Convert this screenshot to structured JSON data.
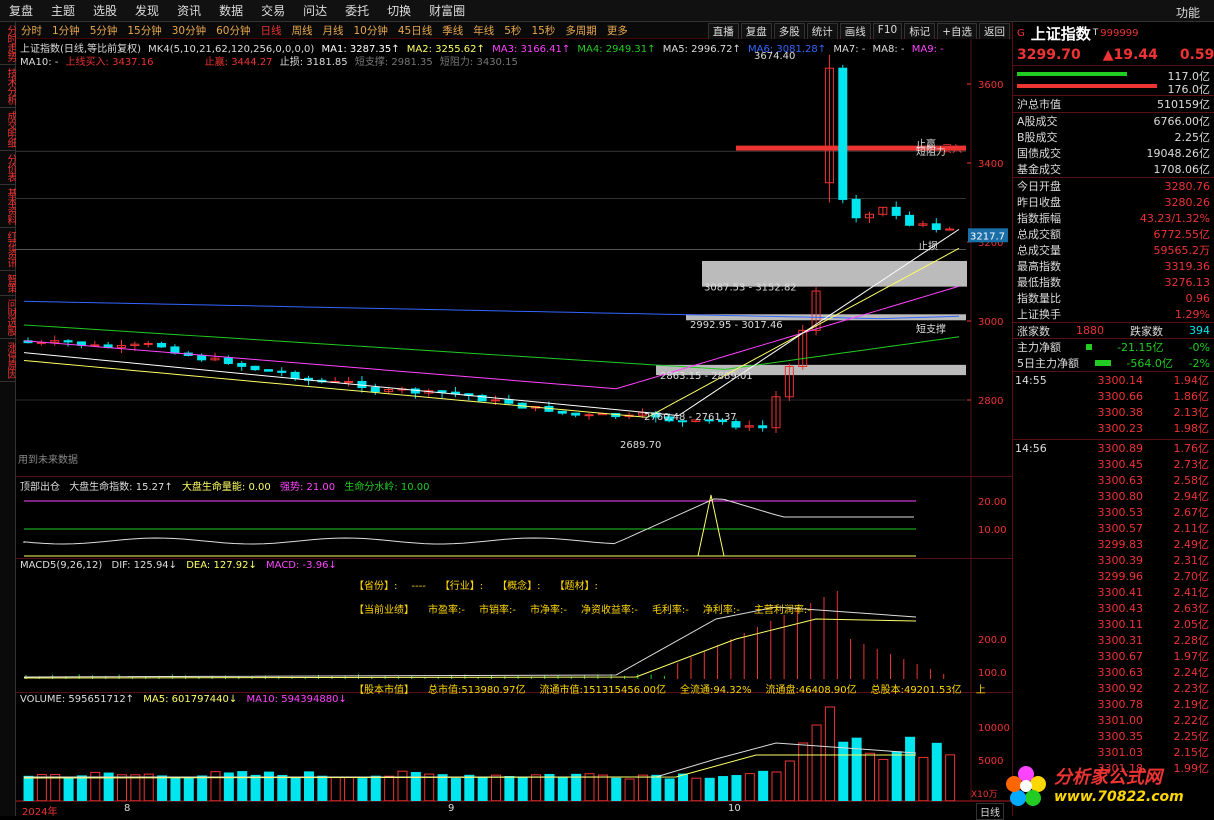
{
  "menu": [
    "复盘",
    "主题",
    "选股",
    "发现",
    "资讯",
    "数据",
    "交易",
    "问达",
    "委托",
    "切换",
    "财富圈"
  ],
  "func_label": "功能",
  "periods": [
    "分时",
    "1分钟",
    "5分钟",
    "15分钟",
    "30分钟",
    "60分钟",
    "日线",
    "周线",
    "月线",
    "10分钟",
    "45日线",
    "季线",
    "年线",
    "5秒",
    "15秒",
    "多周期",
    "更多"
  ],
  "active_period": "日线",
  "tools": [
    "直播",
    "复盘",
    "多股",
    "统计",
    "画线",
    "F10",
    "标记",
    "+自选",
    "返回"
  ],
  "vtabs": [
    "分时走势",
    "技术分析",
    "成交明细",
    "分价表",
    "基本资料",
    "红花资讯",
    "智策",
    "问财选股",
    "涨停原因"
  ],
  "main_legend": {
    "title": "上证指数(日线,等比前复权)",
    "mk": "MK4(5,10,21,62,120,256,0,0,0,0)",
    "ma1": "MA1: 3287.35↑",
    "ma2": "MA2: 3255.62↑",
    "ma3": "MA3: 3166.41↑",
    "ma4": "MA4: 2949.31↑",
    "ma5": "MA5: 2996.72↑",
    "ma6": "MA6: 3081.28↑",
    "ma7": "MA7: -",
    "ma8": "MA8: -",
    "ma9": "MA9: -",
    "ma10": "MA10: -",
    "buy": "上线买入: 3437.16",
    "take": "止赢: 3444.27",
    "stop": "止损: 3181.85",
    "support": "短支撑: 2981.35",
    "resist": "短阻力: 3430.15"
  },
  "main_labels": {
    "high": "3674.40",
    "z1": "3087.53 - 3152.82",
    "z2": "2992.95 - 3017.46",
    "z3": "2863.15 - 2889.01",
    "z4": "2760.48 - 2761.37",
    "low": "2689.70",
    "stop": "止损",
    "support": "短支撑",
    "take": "止赢",
    "resist": "短阻力",
    "buy": "买入",
    "note": "用到未来数据",
    "cur": "3217.7"
  },
  "price_ticks": [
    "3600",
    "3400",
    "3200",
    "3000",
    "2800"
  ],
  "ind1": {
    "name": "顶部出仓",
    "a": "大盘生命指数: 15.27↑",
    "b": "大盘生命量能: 0.00",
    "c": "强势: 21.00",
    "d": "生命分水岭: 10.00",
    "t1": "20.00",
    "t2": "10.00"
  },
  "ind2": {
    "name": "MACD5(9,26,12)",
    "dif": "DIF: 125.94↓",
    "dea": "DEA: 127.92↓",
    "macd": "MACD: -3.96↓",
    "t1": "200.0",
    "t2": "100.0",
    "line1": [
      "【省份】:",
      "----",
      "【行业】:",
      "【概念】:",
      "【题材】:"
    ],
    "line2": [
      "【当前业绩】",
      "市盈率:-",
      "市销率:-",
      "市净率:-",
      "净资收益率:-",
      "毛利率:-",
      "净利率:-",
      "主营利润率:-"
    ],
    "line3": [
      "【股本市值】",
      "总市值:513980.97亿",
      "流通市值:151315456.00亿",
      "全流通:94.32%",
      "流通盘:46408.90亿",
      "总股本:49201.53亿",
      "上"
    ]
  },
  "ind3": {
    "name": "VOLUME: 595651712↑",
    "ma5": "MA5: 601797440↓",
    "ma10": "MA10: 594394880↓",
    "t1": "10000",
    "t2": "5000",
    "unit": "X10万"
  },
  "xaxis": {
    "y": "2024年",
    "m8": "8",
    "m9": "9",
    "m10": "10",
    "period": "日线"
  },
  "quote": {
    "g": "G",
    "name": "上证指数",
    "sup": "T",
    "code": "999999",
    "price": "3299.70",
    "change": "▲19.44",
    "pct": "0.59%",
    "buy_amt": "117.0亿",
    "sell_amt": "176.0亿",
    "rows1": [
      [
        "沪总市值",
        "510159亿"
      ]
    ],
    "rows2": [
      [
        "A股成交",
        "6766.00亿"
      ],
      [
        "B股成交",
        "2.25亿"
      ],
      [
        "国债成交",
        "19048.26亿"
      ],
      [
        "基金成交",
        "1708.06亿"
      ]
    ],
    "rows3": [
      [
        "今日开盘",
        "3280.76"
      ],
      [
        "昨日收盘",
        "3280.26"
      ],
      [
        "指数振幅",
        "43.23/1.32%"
      ],
      [
        "总成交额",
        "6772.55亿"
      ],
      [
        "总成交量",
        "59565.2万"
      ],
      [
        "最高指数",
        "3319.36"
      ],
      [
        "最低指数",
        "3276.13"
      ],
      [
        "指数量比",
        "0.96"
      ],
      [
        "上证换手",
        "1.29%"
      ]
    ],
    "up_label": "涨家数",
    "up": "1880",
    "down_label": "跌家数",
    "down": "394",
    "flow1_label": "主力净额",
    "flow1": "-21.15亿",
    "flow1p": "-0%",
    "flow2_label": "5日主力净额",
    "flow2": "-564.0亿",
    "flow2p": "-2%",
    "t1": "14:55",
    "t2": "14:56",
    "ticks1": [
      [
        "3300.14",
        "1.94亿"
      ],
      [
        "3300.66",
        "1.86亿"
      ],
      [
        "3300.38",
        "2.13亿"
      ],
      [
        "3300.23",
        "1.98亿"
      ]
    ],
    "ticks2": [
      [
        "3300.89",
        "1.76亿"
      ],
      [
        "3300.45",
        "2.73亿"
      ],
      [
        "3300.63",
        "2.58亿"
      ],
      [
        "3300.80",
        "2.94亿"
      ],
      [
        "3300.53",
        "2.67亿"
      ],
      [
        "3300.57",
        "2.11亿"
      ],
      [
        "3299.83",
        "2.49亿"
      ],
      [
        "3300.39",
        "2.31亿"
      ],
      [
        "3299.96",
        "2.70亿"
      ],
      [
        "3300.41",
        "2.41亿"
      ],
      [
        "3300.43",
        "2.63亿"
      ],
      [
        "3300.11",
        "2.05亿"
      ],
      [
        "3300.31",
        "2.28亿"
      ],
      [
        "3300.67",
        "1.97亿"
      ],
      [
        "3300.63",
        "2.24亿"
      ],
      [
        "3300.92",
        "2.23亿"
      ],
      [
        "3300.78",
        "2.19亿"
      ],
      [
        "3301.00",
        "2.22亿"
      ],
      [
        "3300.35",
        "2.25亿"
      ],
      [
        "3301.03",
        "2.15亿"
      ],
      [
        "3301.18",
        "1.99亿"
      ]
    ]
  },
  "logo": {
    "name": "分析家公式网",
    "url": "www.70822.com"
  },
  "colors": {
    "up": "#e33",
    "down": "#00e5ee",
    "ma1": "#ffffff",
    "ma2": "#ffff66",
    "ma3": "#ff44ff",
    "ma4": "#22cc22",
    "ma6": "#3366ff"
  }
}
